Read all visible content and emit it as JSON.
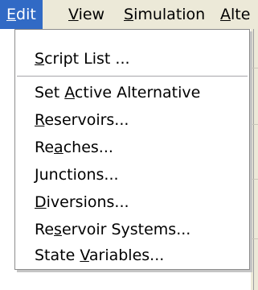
{
  "menubar": {
    "items": [
      {
        "label": "Edit",
        "mnemonic": "E",
        "rest": "dit",
        "active": true
      },
      {
        "label": "View",
        "mnemonic": "V",
        "rest": "iew",
        "active": false
      },
      {
        "label": "Simulation",
        "mnemonic": "S",
        "rest": "imulation",
        "active": false
      },
      {
        "label": "Alte",
        "mnemonic": "A",
        "rest": "lte",
        "active": false
      }
    ]
  },
  "edit_menu": {
    "items": [
      {
        "pre": "",
        "mnemonic": "S",
        "post": "cript List ..."
      },
      {
        "pre": "Set ",
        "mnemonic": "A",
        "post": "ctive Alternative"
      },
      {
        "pre": "",
        "mnemonic": "R",
        "post": "eservoirs..."
      },
      {
        "pre": "Re",
        "mnemonic": "a",
        "post": "ches..."
      },
      {
        "pre": "",
        "mnemonic": "J",
        "post": "unctions..."
      },
      {
        "pre": "",
        "mnemonic": "D",
        "post": "iversions..."
      },
      {
        "pre": "Re",
        "mnemonic": "s",
        "post": "ervoir Systems..."
      },
      {
        "pre": "State ",
        "mnemonic": "V",
        "post": "ariables..."
      }
    ]
  },
  "colors": {
    "menubar_bg": "#ece9d8",
    "highlight": "#316ac5",
    "menu_bg": "#ffffff"
  }
}
